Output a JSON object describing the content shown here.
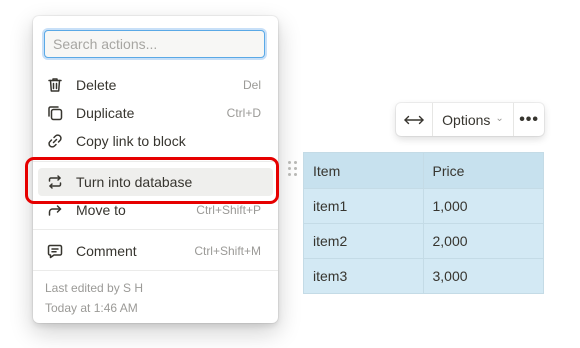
{
  "menu": {
    "search": {
      "placeholder": "Search actions..."
    },
    "items": [
      {
        "label": "Delete",
        "shortcut": "Del",
        "icon": "trash-icon"
      },
      {
        "label": "Duplicate",
        "shortcut": "Ctrl+D",
        "icon": "duplicate-icon"
      },
      {
        "label": "Copy link to block",
        "shortcut": "",
        "icon": "link-icon"
      },
      {
        "label": "Turn into database",
        "shortcut": "",
        "icon": "turn-into-icon",
        "highlighted": true
      },
      {
        "label": "Move to",
        "shortcut": "Ctrl+Shift+P",
        "icon": "move-to-icon"
      },
      {
        "label": "Comment",
        "shortcut": "Ctrl+Shift+M",
        "icon": "comment-icon"
      }
    ],
    "last_edited_by": "Last edited by S H",
    "last_edited_time": "Today at 1:46 AM"
  },
  "toolbar": {
    "resize_icon": "arrows-horizontal-icon",
    "options_label": "Options",
    "more_label": "•••"
  },
  "table": {
    "columns": [
      "Item",
      "Price"
    ],
    "rows": [
      [
        "item1",
        "1,000"
      ],
      [
        "item2",
        "2,000"
      ],
      [
        "item3",
        "3,000"
      ]
    ]
  },
  "colors": {
    "table_background": "#d3e9f4",
    "table_header_background": "#c7e1ee",
    "highlight_outline": "#e60000",
    "search_focus": "#5aa9e6"
  }
}
